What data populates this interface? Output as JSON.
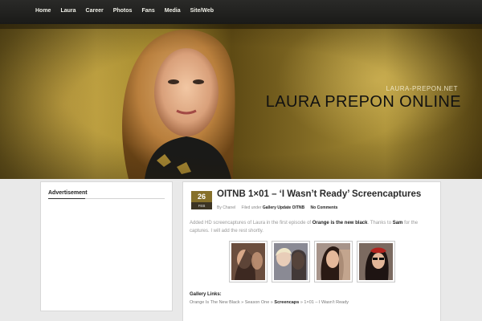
{
  "nav": {
    "items": [
      {
        "label": "Home"
      },
      {
        "label": "Laura"
      },
      {
        "label": "Career"
      },
      {
        "label": "Photos"
      },
      {
        "label": "Fans"
      },
      {
        "label": "Media"
      },
      {
        "label": "Site/Web"
      }
    ]
  },
  "header": {
    "subtitle": "LAURA-PREPON.NET",
    "title": "LAURA PREPON ONLINE"
  },
  "sidebar": {
    "widget_title": "Advertisement"
  },
  "post": {
    "date_day": "26",
    "date_month": "FEB",
    "title": "OITNB 1×01 – ‘I Wasn’t Ready’ Screencaptures",
    "meta": {
      "by_label": "By",
      "author": "Chanel",
      "filed_label": "Filed under",
      "category1": "Gallery Update",
      "category2": "OITNB",
      "comments": "No Comments"
    },
    "body": {
      "part1": "Added HD screencaptures of Laura in the first episode of ",
      "show": "Orange is the new black",
      "part2": ". Thanks to ",
      "thanks": "Sam",
      "part3": " for the captures. I will add the rest shortly."
    },
    "thumbnails": [
      {
        "name": "screencap-1"
      },
      {
        "name": "screencap-2"
      },
      {
        "name": "screencap-3"
      },
      {
        "name": "screencap-4"
      }
    ],
    "gallery_links_label": "Gallery Links:",
    "gallery_path": {
      "p1": "Orange Is The New Black",
      "sep": " » ",
      "p2": "Season One",
      "p3": "Screencaps",
      "p4": "1×01 – I Wasn’t Ready"
    }
  },
  "colors": {
    "nav_bg": "#1f1f1d",
    "accent_gold": "#86702a",
    "banner_gold": "#a88c2e",
    "page_bg": "#e9e9e9"
  }
}
